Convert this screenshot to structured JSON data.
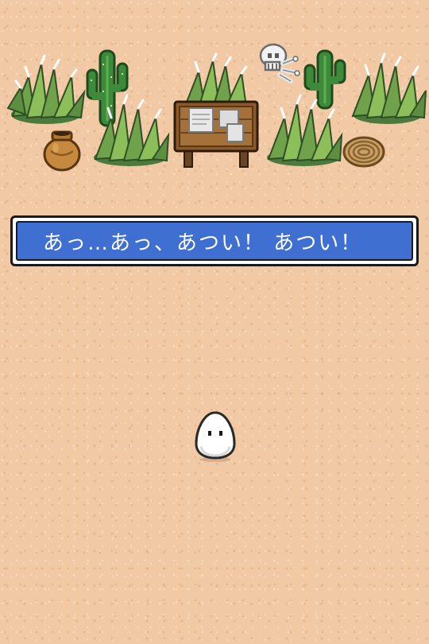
{
  "dialog": {
    "text": "あっ…あっ、あつい！ あつい！"
  },
  "scene": {
    "objects": [
      "grass-icon",
      "cactus-icon",
      "grass-icon",
      "skull-bones-icon",
      "cactus-icon",
      "grass-icon",
      "clay-pot-icon",
      "grass-icon",
      "notice-board-icon",
      "grass-icon",
      "rope-coil-icon",
      "egg-creature-icon"
    ]
  }
}
